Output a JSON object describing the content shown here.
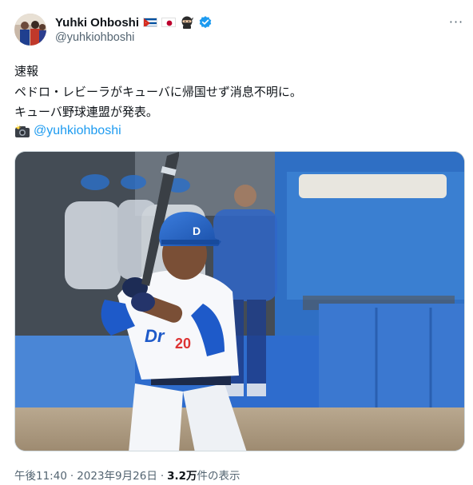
{
  "author": {
    "display_name": "Yuhki Ohboshi",
    "handle": "@yuhkiohboshi",
    "badges": [
      "cuba-flag-icon",
      "japan-flag-icon",
      "ninja-icon",
      "verified-badge-icon"
    ],
    "verified_color": "#1d9bf0"
  },
  "more_label": "···",
  "tweet": {
    "line1": "速報",
    "line2": "ペドロ・レビーラがキューバに帰国せず消息不明に。",
    "line3": "キューバ野球連盟が発表。",
    "mention": "@yuhkiohboshi",
    "mention_icon": "camera-flash-icon"
  },
  "media": {
    "description_icon": "baseball-batter-photo"
  },
  "footer": {
    "time": "午後11:40",
    "date": "2023年9月26日",
    "views": "3.2万",
    "views_suffix": " 件の表示",
    "separator": "·"
  },
  "colors": {
    "text": "#0f1419",
    "muted": "#536471",
    "link": "#1d9bf0"
  }
}
